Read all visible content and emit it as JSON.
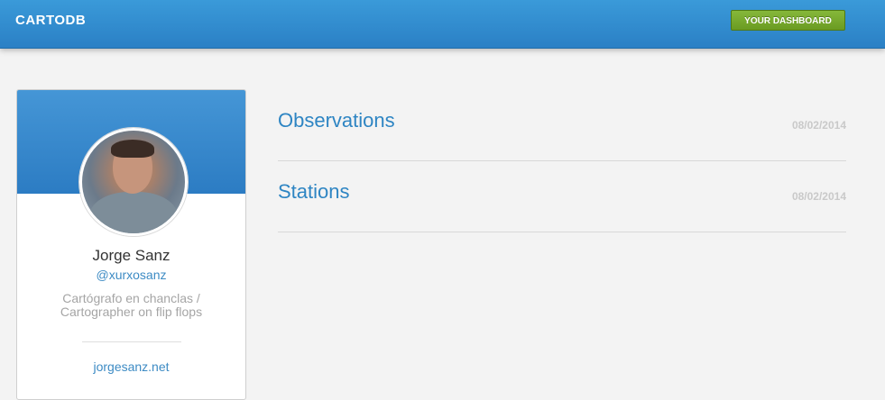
{
  "header": {
    "logo": "CARTODB",
    "dashboard_button": "YOUR DASHBOARD"
  },
  "profile": {
    "name": "Jorge Sanz",
    "handle": "@xurxosanz",
    "bio": "Cartógrafo en chanclas / Cartographer on flip flops",
    "website": "jorgesanz.net"
  },
  "tables": [
    {
      "title": "Observations",
      "date": "08/02/2014"
    },
    {
      "title": "Stations",
      "date": "08/02/2014"
    }
  ]
}
